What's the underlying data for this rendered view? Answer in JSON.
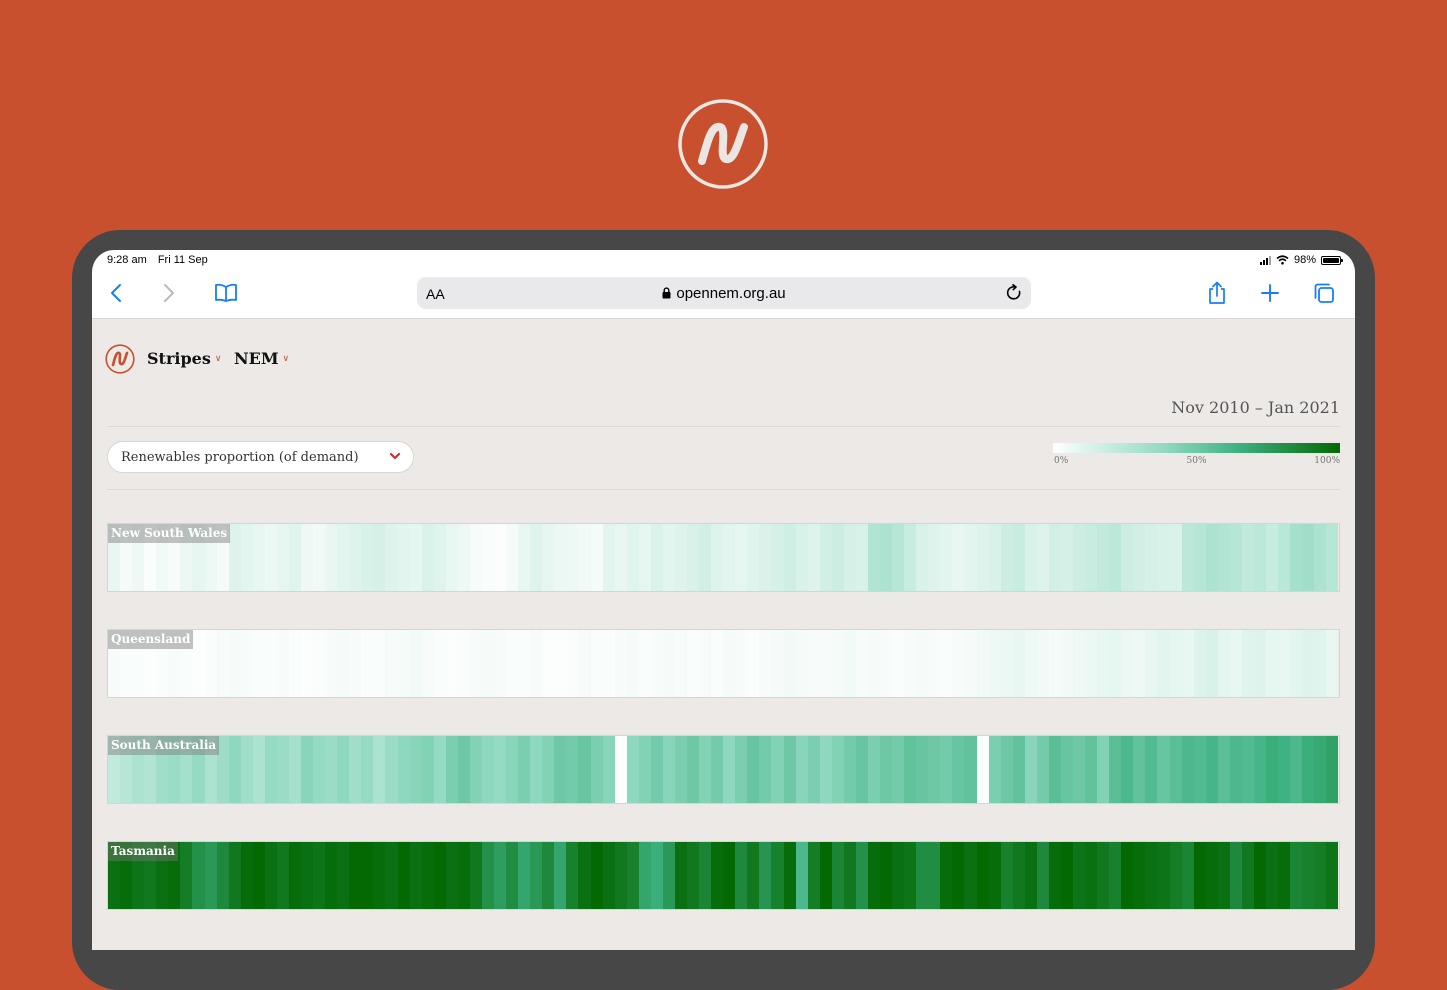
{
  "colors": {
    "page_bg": "#C9502F",
    "content_bg": "#ECE9E6",
    "accent": "#C9502F",
    "ios_blue": "#147EFB",
    "scale_low": "#FFFFFF",
    "scale_mid": "#8FD8C0",
    "scale_high": "#046803"
  },
  "status_bar": {
    "time": "9:28 am",
    "date": "Fri 11 Sep",
    "battery": "98%"
  },
  "browser": {
    "text_size_label": "AA",
    "url": "opennem.org.au",
    "icons": [
      "back-icon",
      "forward-icon",
      "bookmarks-icon",
      "lock-icon",
      "reload-icon",
      "share-icon",
      "new-tab-icon",
      "tabs-icon"
    ]
  },
  "app": {
    "nav": {
      "view_label": "Stripes",
      "region_label": "NEM"
    },
    "date_range": "Nov 2010 – Jan 2021",
    "metric_selected": "Renewables proportion (of demand)",
    "legend": {
      "min_label": "0%",
      "mid_label": "50%",
      "max_label": "100%"
    }
  },
  "chart_data": {
    "type": "heatmap",
    "title": "",
    "xlabel": "",
    "ylabel": "",
    "x_range": [
      "Nov 2010",
      "Jan 2021"
    ],
    "value_range": [
      0,
      100
    ],
    "legend_ticks": [
      "0%",
      "50%",
      "100%"
    ],
    "rows": [
      {
        "name": "New South Wales",
        "values": [
          8,
          4,
          6,
          2,
          5,
          3,
          7,
          9,
          6,
          4,
          12,
          10,
          8,
          7,
          9,
          11,
          6,
          5,
          8,
          10,
          12,
          14,
          15,
          12,
          10,
          9,
          13,
          11,
          8,
          6,
          3,
          2,
          1,
          4,
          8,
          12,
          9,
          7,
          6,
          5,
          4,
          10,
          8,
          11,
          9,
          13,
          10,
          12,
          14,
          16,
          12,
          10,
          9,
          11,
          13,
          15,
          17,
          14,
          12,
          16,
          18,
          15,
          14,
          28,
          30,
          26,
          20,
          14,
          12,
          10,
          8,
          10,
          12,
          14,
          18,
          20,
          14,
          12,
          16,
          15,
          18,
          20,
          22,
          24,
          18,
          16,
          15,
          14,
          13,
          24,
          26,
          30,
          28,
          26,
          22,
          24,
          20,
          25,
          32,
          34,
          30,
          26
        ]
      },
      {
        "name": "Queensland",
        "values": [
          3,
          2,
          2,
          1,
          2,
          3,
          2,
          1,
          2,
          3,
          4,
          3,
          2,
          2,
          3,
          2,
          1,
          2,
          3,
          4,
          3,
          2,
          2,
          3,
          4,
          5,
          3,
          2,
          1,
          2,
          3,
          4,
          3,
          2,
          2,
          3,
          1,
          1,
          2,
          3,
          2,
          2,
          3,
          4,
          2,
          3,
          4,
          3,
          2,
          3,
          2,
          4,
          3,
          2,
          3,
          4,
          5,
          4,
          3,
          3,
          4,
          5,
          3,
          4,
          3,
          2,
          3,
          4,
          3,
          2,
          3,
          4,
          5,
          6,
          7,
          8,
          6,
          5,
          4,
          5,
          6,
          7,
          8,
          9,
          7,
          6,
          8,
          10,
          9,
          8,
          12,
          14,
          10,
          8,
          11,
          12,
          9,
          8,
          10,
          12,
          11,
          8
        ]
      },
      {
        "name": "South Australia",
        "values": [
          22,
          26,
          30,
          28,
          34,
          36,
          32,
          38,
          30,
          35,
          40,
          34,
          30,
          38,
          36,
          32,
          42,
          38,
          36,
          40,
          34,
          38,
          30,
          36,
          40,
          42,
          44,
          38,
          46,
          50,
          44,
          40,
          38,
          42,
          46,
          40,
          44,
          50,
          48,
          52,
          46,
          42,
          1,
          40,
          44,
          48,
          42,
          46,
          50,
          44,
          48,
          40,
          46,
          52,
          48,
          44,
          50,
          42,
          46,
          40,
          44,
          48,
          52,
          46,
          50,
          48,
          54,
          52,
          50,
          48,
          52,
          54,
          2,
          46,
          50,
          54,
          42,
          48,
          56,
          52,
          50,
          54,
          44,
          56,
          60,
          54,
          58,
          52,
          56,
          60,
          58,
          62,
          56,
          60,
          58,
          62,
          66,
          64,
          60,
          66,
          68,
          72
        ]
      },
      {
        "name": "Tasmania",
        "values": [
          96,
          98,
          94,
          92,
          96,
          98,
          90,
          80,
          76,
          84,
          92,
          98,
          100,
          96,
          92,
          98,
          96,
          94,
          98,
          96,
          100,
          100,
          98,
          96,
          100,
          96,
          98,
          100,
          96,
          98,
          92,
          80,
          74,
          82,
          70,
          76,
          84,
          70,
          88,
          96,
          100,
          96,
          92,
          88,
          70,
          66,
          76,
          96,
          92,
          86,
          98,
          100,
          84,
          92,
          78,
          88,
          98,
          60,
          90,
          100,
          86,
          92,
          80,
          98,
          100,
          96,
          94,
          82,
          82,
          98,
          100,
          96,
          100,
          98,
          88,
          92,
          96,
          84,
          98,
          100,
          94,
          96,
          92,
          88,
          100,
          98,
          96,
          94,
          90,
          86,
          100,
          98,
          96,
          84,
          92,
          100,
          96,
          98,
          86,
          88,
          90,
          94
        ]
      }
    ]
  }
}
